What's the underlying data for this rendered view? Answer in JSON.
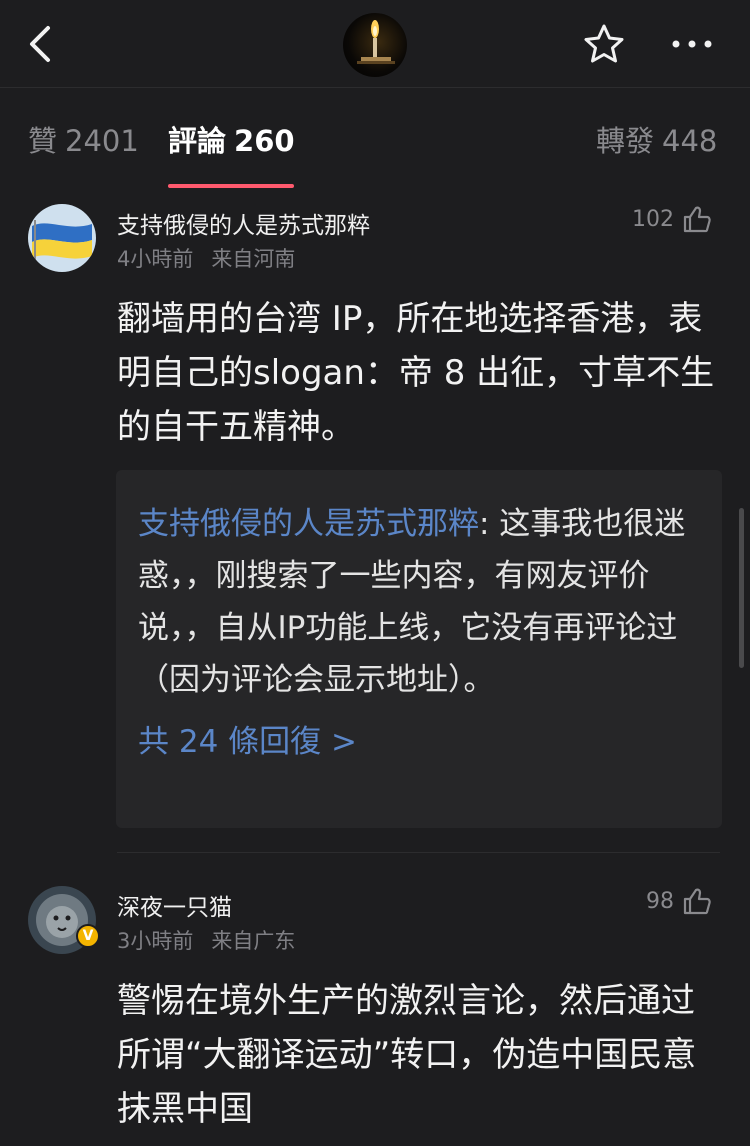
{
  "tabs": [
    {
      "label": "贊",
      "count": "2401"
    },
    {
      "label": "評論",
      "count": "260"
    },
    {
      "label": "轉發",
      "count": "448"
    }
  ],
  "comments": [
    {
      "name": "支持俄侵的人是苏式那粹",
      "time": "4小時前",
      "location": "来自河南",
      "likes": "102",
      "body": "翻墙用的台湾 IP，所在地选择香港，表明自己的slogan：帝 8 出征，寸草不生的自干五精神。",
      "reply": {
        "author": "支持俄侵的人是苏式那粹",
        "text": ": 这事我也很迷惑，，刚搜索了一些内容，有网友评价说，，自从IP功能上线，它没有再评论过（因为评论会显示地址）。",
        "more": "共 24 條回復 >"
      }
    },
    {
      "name": "深夜一只猫",
      "time": "3小時前",
      "location": "来自广东",
      "likes": "98",
      "badge": "V",
      "body": "警惕在境外生产的激烈言论，然后通过所谓“大翻译运动”转口，伪造中国民意抹黑中国"
    }
  ],
  "colors": {
    "background": "#1d1d1f",
    "accent_underline": "#ff5a6e",
    "link": "#5b86c8",
    "badge": "#f4b400"
  },
  "icons": [
    "back-arrow-icon",
    "star-icon",
    "more-dots-icon",
    "thumbs-up-icon"
  ]
}
